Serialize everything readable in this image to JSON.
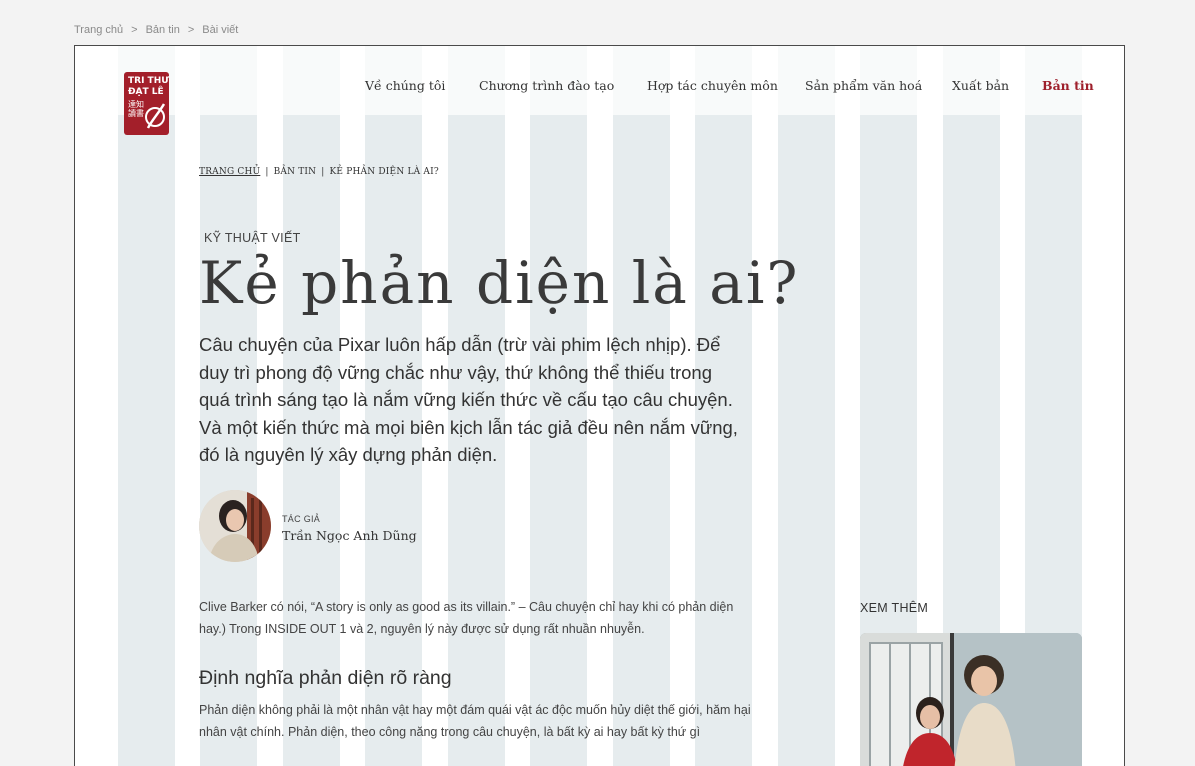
{
  "top_breadcrumb": [
    "Trang chủ",
    "Bản tin",
    "Bài viết"
  ],
  "breadcrumb_separator": ">",
  "logo": {
    "line1": "TRI THƯ",
    "line2": "ĐẠT LÊ",
    "seal": "達知\n讀書"
  },
  "nav": {
    "items": [
      "Về chúng tôi",
      "Chương trình đào tạo",
      "Hợp tác chuyên môn",
      "Sản phẩm văn hoá",
      "Xuất bản",
      "Bản tin"
    ],
    "active": "Bản tin"
  },
  "article": {
    "breadcrumb": [
      "TRANG CHỦ",
      "BẢN TIN",
      "KẺ PHẢN DIỆN LÀ AI?"
    ],
    "breadcrumb_separator": "|",
    "category": "KỸ THUẬT VIẾT",
    "title": "Kẻ phản diện là ai?",
    "lead": "Câu chuyện của Pixar luôn hấp dẫn (trừ vài phim lệch nhịp). Để duy trì phong độ vững chắc như vậy, thứ không thể thiếu trong quá trình sáng tạo là nắm vững kiến thức về cấu tạo câu chuyện. Và một kiến thức mà mọi biên kịch lẫn tác giả đều nên nắm vững, đó là nguyên lý xây dựng phản diện.",
    "author_label": "TÁC GIẢ",
    "author_name": "Trần Ngọc Anh Dũng",
    "intro": "Clive Barker có nói, “A story is only as good as its villain.” – Câu chuyện chỉ hay khi có phản diện hay.) Trong INSIDE OUT 1 và 2, nguyên lý này được sử dụng rất nhuần nhuyễn.",
    "section_heading": "Định nghĩa phản diện rõ ràng",
    "section_body": "Phản diện không phải là một nhân vật hay một đám quái vật ác độc muốn hủy diệt thế giới, hăm hại nhân vật chính. Phản diện, theo công năng trong câu chuyện, là bất kỳ ai hay bất kỳ thứ gì"
  },
  "aside": {
    "label": "XEM THÊM"
  },
  "colors": {
    "accent": "#9e1f2b",
    "logo_bg": "#a31f2a",
    "grid_overlay": "#becdd2"
  }
}
